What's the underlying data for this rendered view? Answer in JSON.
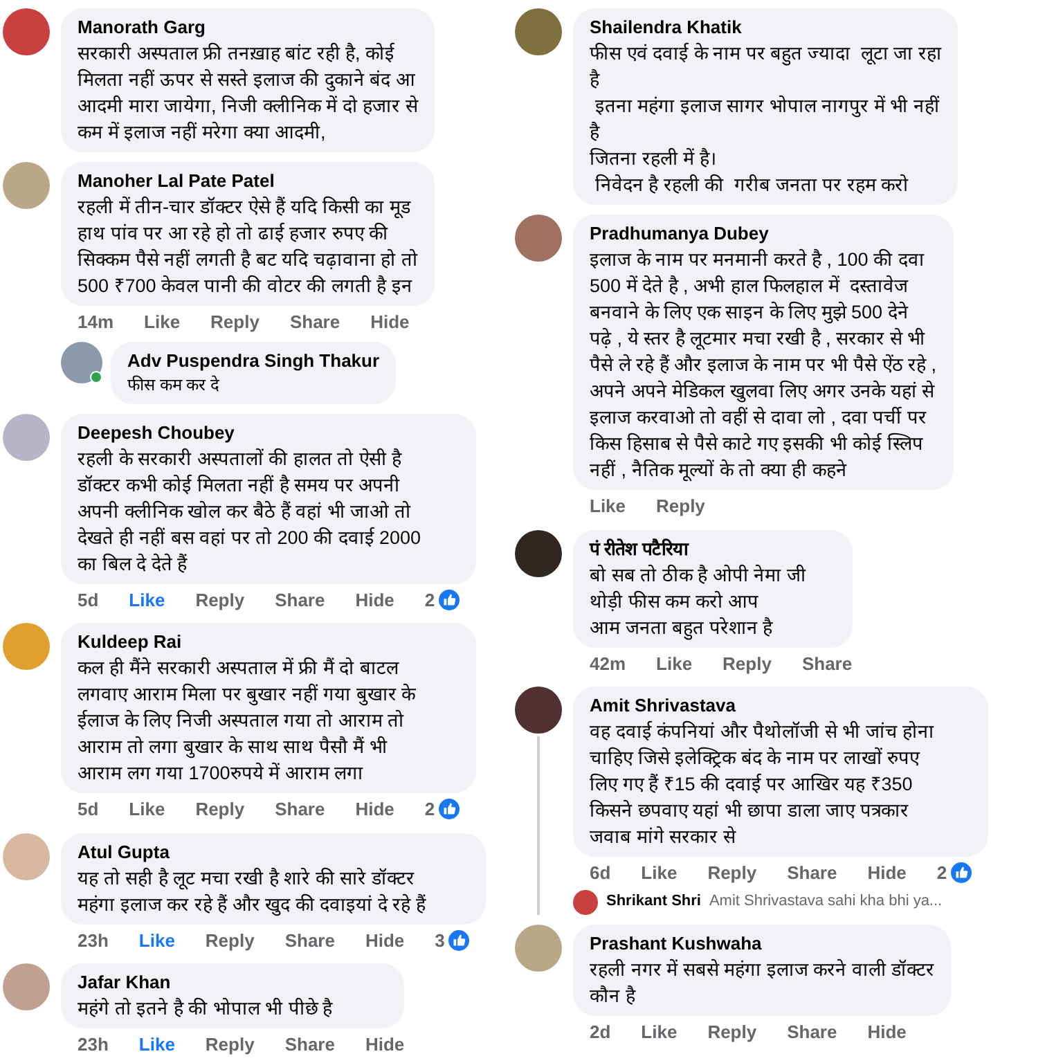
{
  "columns": [
    {
      "comments": [
        {
          "author": "Manorath Garg",
          "lines": [
            "सरकारी अस्पताल फ्री तनख़ाह बांट रही है, कोई",
            "मिलता नहीं ऊपर से सस्ते इलाज की दुकाने बंद आ",
            "आदमी मारा जायेगा, निजी क्लीनिक में दो हजार से",
            "कम में इलाज नहीं मरेगा क्या आदमी,"
          ]
        },
        {
          "author": "Manoher Lal Pate Patel",
          "lines": [
            "रहली में तीन-चार डॉक्टर ऐसे हैं यदि किसी का मूड",
            "हाथ पांव पर आ रहे हो तो ढाई हजार रुपए की",
            "सिक्कम पैसे नहीं लगती है बट यदि चढ़ावाना हो तो",
            "500 ₹700 केवल पानी की वोटर की लगती है इन"
          ],
          "footer": {
            "time": "14m",
            "like_label": "Like",
            "liked": false,
            "actions": [
              "Reply",
              "Share",
              "Hide"
            ]
          },
          "replies": [
            {
              "author": "Adv Puspendra Singh Thakur",
              "online": true,
              "lines": [
                "फीस कम कर दे"
              ]
            }
          ]
        },
        {
          "author": "Deepesh Choubey",
          "lines": [
            "रहली के सरकारी अस्पतालों की हालत तो ऐसी है",
            "डॉक्टर कभी कोई मिलता नहीं है समय पर अपनी",
            "अपनी क्लीनिक खोल कर बैठे हैं वहां भी जाओ तो",
            "देखते ही नहीं बस वहां पर तो 200 की दवाई 2000",
            "का बिल दे देते हैं"
          ],
          "footer": {
            "time": "5d",
            "like_label": "Like",
            "liked": true,
            "actions": [
              "Reply",
              "Share",
              "Hide"
            ],
            "reaction_count": "2"
          }
        },
        {
          "author": "Kuldeep Rai",
          "lines": [
            "कल ही मैंने सरकारी अस्पताल में फ्री मैं दो बाटल",
            "लगवाए आराम मिला पर बुखार नहीं गया बुखार के",
            "ईलाज के लिए निजी अस्पताल गया तो आराम तो",
            "आराम तो लगा बुखार के साथ साथ पैसौ मैं भी",
            "आराम लग गया 1700रुपये में आराम लगा"
          ],
          "footer": {
            "time": "5d",
            "like_label": "Like",
            "liked": false,
            "actions": [
              "Reply",
              "Share",
              "Hide"
            ],
            "reaction_count": "2"
          }
        },
        {
          "author": "Atul Gupta",
          "lines": [
            "यह तो सही है लूट मचा रखी है शारे की सारे डॉक्टर",
            "महंगा इलाज कर रहे हैं और खुद की दवाइयां दे रहे हैं"
          ],
          "footer": {
            "time": "23h",
            "like_label": "Like",
            "liked": true,
            "actions": [
              "Reply",
              "Share",
              "Hide"
            ],
            "reaction_count": "3"
          }
        },
        {
          "author": "Jafar Khan",
          "lines": [
            "महंगे तो इतने है की भोपाल भी पीछे है"
          ],
          "footer": {
            "time": "23h",
            "like_label": "Like",
            "liked": true,
            "actions": [
              "Reply",
              "Share",
              "Hide"
            ]
          }
        }
      ]
    },
    {
      "comments": [
        {
          "author": "Shailendra Khatik",
          "lines": [
            "फीस एवं दवाई के नाम पर बहुत ज्यादा  लूटा जा रहा",
            "है",
            " इतना महंगा इलाज सागर भोपाल नागपुर में भी नहीं",
            "है",
            "जितना रहली में है।",
            " निवेदन है रहली की  गरीब जनता पर रहम करो"
          ]
        },
        {
          "author": "Pradhumanya Dubey",
          "lines": [
            "इलाज के नाम पर मनमानी करते है , 100 की दवा",
            "500 में देते है , अभी हाल फिलहाल में  दस्तावेज",
            "बनवाने के लिए एक साइन के लिए मुझे 500 देने",
            "पढ़े , ये स्तर है लूटमार मचा रखी है , सरकार से भी",
            "पैसे ले रहे हैं और इलाज के नाम पर भी पैसे ऐंठ रहे ,",
            "अपने अपने मेडिकल खुलवा लिए अगर उनके यहां से",
            "इलाज करवाओ तो वहीं से दावा लो , दवा पर्ची पर",
            "किस हिसाब से पैसे काटे गए इसकी भी कोई स्लिप",
            "नहीं , नैतिक मूल्यों के तो क्या ही कहने"
          ],
          "footer": {
            "like_label": "Like",
            "liked": false,
            "actions": [
              "Reply"
            ]
          }
        },
        {
          "author": "पं रीतेश पटैरिया",
          "lines": [
            "बो सब तो ठीक है ओपी नेमा जी",
            "थोड़ी फीस कम करो आप",
            "आम जनता बहुत परेशान है"
          ],
          "footer": {
            "time": "42m",
            "like_label": "Like",
            "liked": false,
            "actions": [
              "Reply",
              "Share"
            ]
          }
        },
        {
          "author": "Amit Shrivastava",
          "lines": [
            "वह दवाई कंपनियां और पैथोलॉजी से भी जांच होना",
            "चाहिए जिसे इलेक्ट्रिक बंद के नाम पर लाखों रुपए",
            "लिए गए हैं ₹15 की दवाई पर आखिर यह ₹350",
            "किसने छपवाए यहां भी छापा डाला जाए पत्रकार",
            "जवाब मांगे सरकार से"
          ],
          "footer": {
            "time": "6d",
            "like_label": "Like",
            "liked": false,
            "actions": [
              "Reply",
              "Share",
              "Hide"
            ],
            "reaction_count": "2"
          },
          "reply_preview": {
            "author": "Shrikant Shri",
            "text": "Amit Shrivastava sahi kha bhi ya..."
          }
        },
        {
          "author": "Prashant Kushwaha",
          "lines": [
            "रहली नगर में सबसे महंगा इलाज करने वाली डॉक्टर",
            "कौन है"
          ],
          "footer": {
            "time": "2d",
            "like_label": "Like",
            "liked": false,
            "actions": [
              "Reply",
              "Share",
              "Hide"
            ]
          }
        }
      ]
    }
  ]
}
